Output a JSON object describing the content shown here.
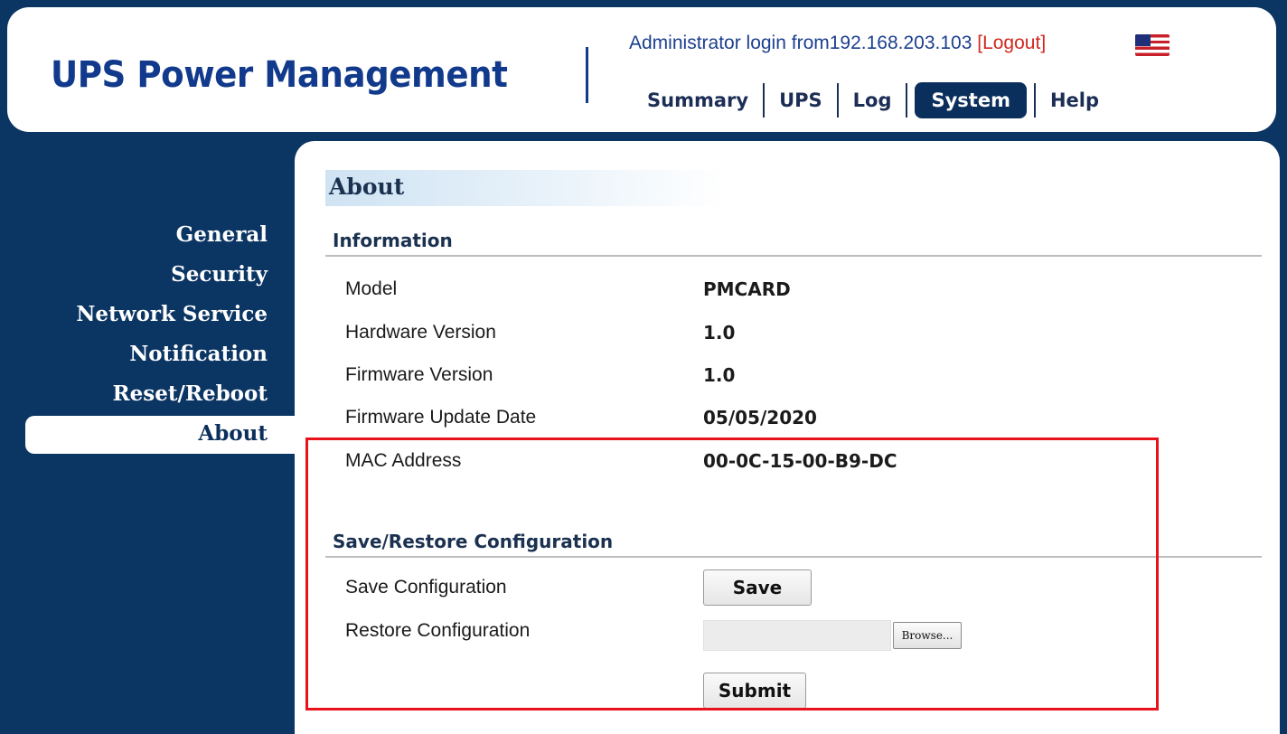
{
  "header": {
    "app_title": "UPS Power Management",
    "login_prefix": "Administrator login from192.168.203.103 ",
    "login_open_bracket": "[",
    "logout_label": "Logout",
    "login_close_bracket": "]",
    "language_flag": "us-flag-icon"
  },
  "nav": {
    "items": [
      {
        "label": "Summary",
        "active": false
      },
      {
        "label": "UPS",
        "active": false
      },
      {
        "label": "Log",
        "active": false
      },
      {
        "label": "System",
        "active": true
      },
      {
        "label": "Help",
        "active": false
      }
    ]
  },
  "sidebar": {
    "items": [
      {
        "label": "General"
      },
      {
        "label": "Security"
      },
      {
        "label": "Network Service"
      },
      {
        "label": "Notification"
      },
      {
        "label": "Reset/Reboot"
      },
      {
        "label": "About",
        "active": true
      }
    ]
  },
  "page": {
    "title": "About",
    "information": {
      "title": "Information",
      "rows": [
        {
          "label": "Model",
          "value": "PMCARD"
        },
        {
          "label": "Hardware Version",
          "value": "1.0"
        },
        {
          "label": "Firmware Version",
          "value": "1.0"
        },
        {
          "label": "Firmware Update Date",
          "value": "05/05/2020"
        },
        {
          "label": "MAC Address",
          "value": "00-0C-15-00-B9-DC"
        }
      ]
    },
    "config": {
      "title": "Save/Restore Configuration",
      "save_label": "Save Configuration",
      "save_button": "Save",
      "restore_label": "Restore Configuration",
      "restore_file_value": "",
      "browse_button": "Browse...",
      "submit_button": "Submit"
    }
  },
  "colors": {
    "frame_bg": "#0b3563",
    "brand_text": "#123a8c",
    "logout": "#d2281f",
    "highlight": "#e8121b"
  }
}
